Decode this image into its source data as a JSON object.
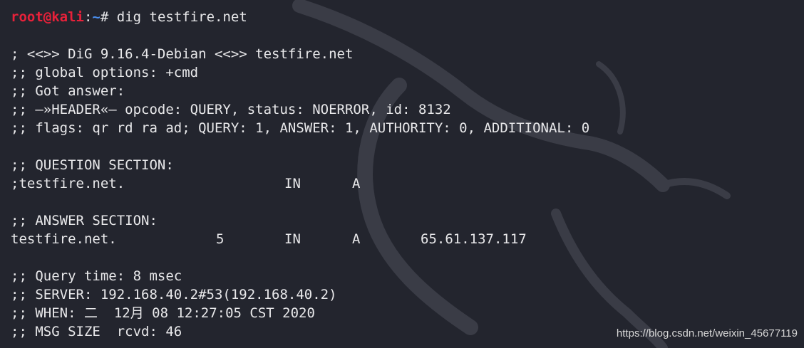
{
  "terminal": {
    "prompt": {
      "user": "root@kali",
      "separator": ":",
      "cwd": "~",
      "symbol": "# ",
      "command": "dig testfire.net"
    },
    "header_line": "; <<>> DiG 9.16.4-Debian <<>> testfire.net",
    "global_options": ";; global options: +cmd",
    "got_answer": ";; Got answer:",
    "header_status": ";; —»HEADER«— opcode: QUERY, status: NOERROR, id: 8132",
    "flags": ";; flags: qr rd ra ad; QUERY: 1, ANSWER: 1, AUTHORITY: 0, ADDITIONAL: 0",
    "question_section": {
      "title": ";; QUESTION SECTION:",
      "name": ";testfire.net.",
      "class": "IN",
      "type": "A"
    },
    "answer_section": {
      "title": ";; ANSWER SECTION:",
      "name": "testfire.net.",
      "ttl": "5",
      "class": "IN",
      "type": "A",
      "address": "65.61.137.117"
    },
    "stats": {
      "query_time": ";; Query time: 8 msec",
      "server": ";; SERVER: 192.168.40.2#53(192.168.40.2)",
      "when": ";; WHEN: 二  12月 08 12:27:05 CST 2020",
      "msg_size": ";; MSG SIZE  rcvd: 46"
    }
  },
  "watermark": "https://blog.csdn.net/weixin_45677119",
  "colors": {
    "background": "#23252e",
    "text": "#e8e8ea",
    "prompt_user": "#e8213a",
    "prompt_path": "#4a8ff0"
  }
}
